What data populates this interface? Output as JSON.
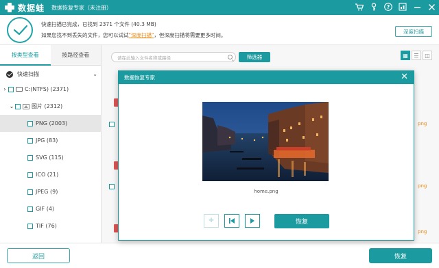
{
  "app": {
    "logo_text": "数据蛙",
    "title": "数据恢复专家（未注册）"
  },
  "titlebar_icons": [
    "cart-icon",
    "key-icon",
    "help-icon",
    "register-icon",
    "minimize-icon",
    "close-icon"
  ],
  "status": {
    "line1": "快速扫描已完成，已找到 2371 个文件 (40.3 MB)",
    "line2_prefix": "如果您找不到丢失的文件，您可以试试",
    "line2_link": "\"深度扫描\"",
    "line2_suffix": "，但深度扫描将需要更多时间。",
    "deep_scan_button": "深度扫描"
  },
  "sidebar": {
    "tabs": [
      {
        "label": "按类型查看",
        "active": true
      },
      {
        "label": "按路径查看",
        "active": false
      }
    ],
    "quick_scan": "快速扫描",
    "drive": "C:(NTFS) (2371)",
    "category": "图片 (2312)",
    "items": [
      {
        "label": "PNG (2003)",
        "selected": true
      },
      {
        "label": "JPG (83)",
        "selected": false
      },
      {
        "label": "SVG (115)",
        "selected": false
      },
      {
        "label": "ICO (21)",
        "selected": false
      },
      {
        "label": "JPEG (9)",
        "selected": false
      },
      {
        "label": "GIF (4)",
        "selected": false
      },
      {
        "label": "TIF (76)",
        "selected": false
      }
    ]
  },
  "main": {
    "search_placeholder": "请在此输入文件名称或路径",
    "filter_button": "筛选器",
    "bg_ext": "png"
  },
  "footer": {
    "back_button": "返回",
    "recover_button": "恢复"
  },
  "modal": {
    "title": "数据恢复专家",
    "filename": "home.png",
    "recover_button": "恢复"
  },
  "colors": {
    "accent": "#1b9aa0",
    "link": "#e8891c"
  }
}
